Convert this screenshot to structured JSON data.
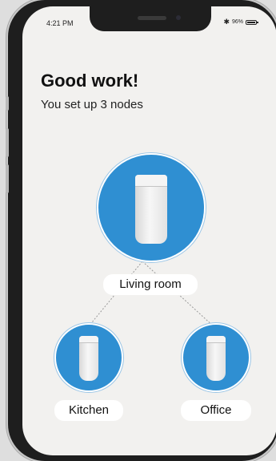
{
  "status_bar": {
    "time": "4:21 PM",
    "battery_text": "96%",
    "battery_level": 0.96
  },
  "header": {
    "title": "Good work!",
    "subtitle": "You set up 3 nodes"
  },
  "nodes": [
    {
      "label": "Living room",
      "icon": "mesh-router-icon"
    },
    {
      "label": "Kitchen",
      "icon": "mesh-router-icon"
    },
    {
      "label": "Office",
      "icon": "mesh-router-icon"
    }
  ],
  "colors": {
    "node_blue": "#2f8fd2",
    "screen_bg": "#f2f1ef"
  }
}
